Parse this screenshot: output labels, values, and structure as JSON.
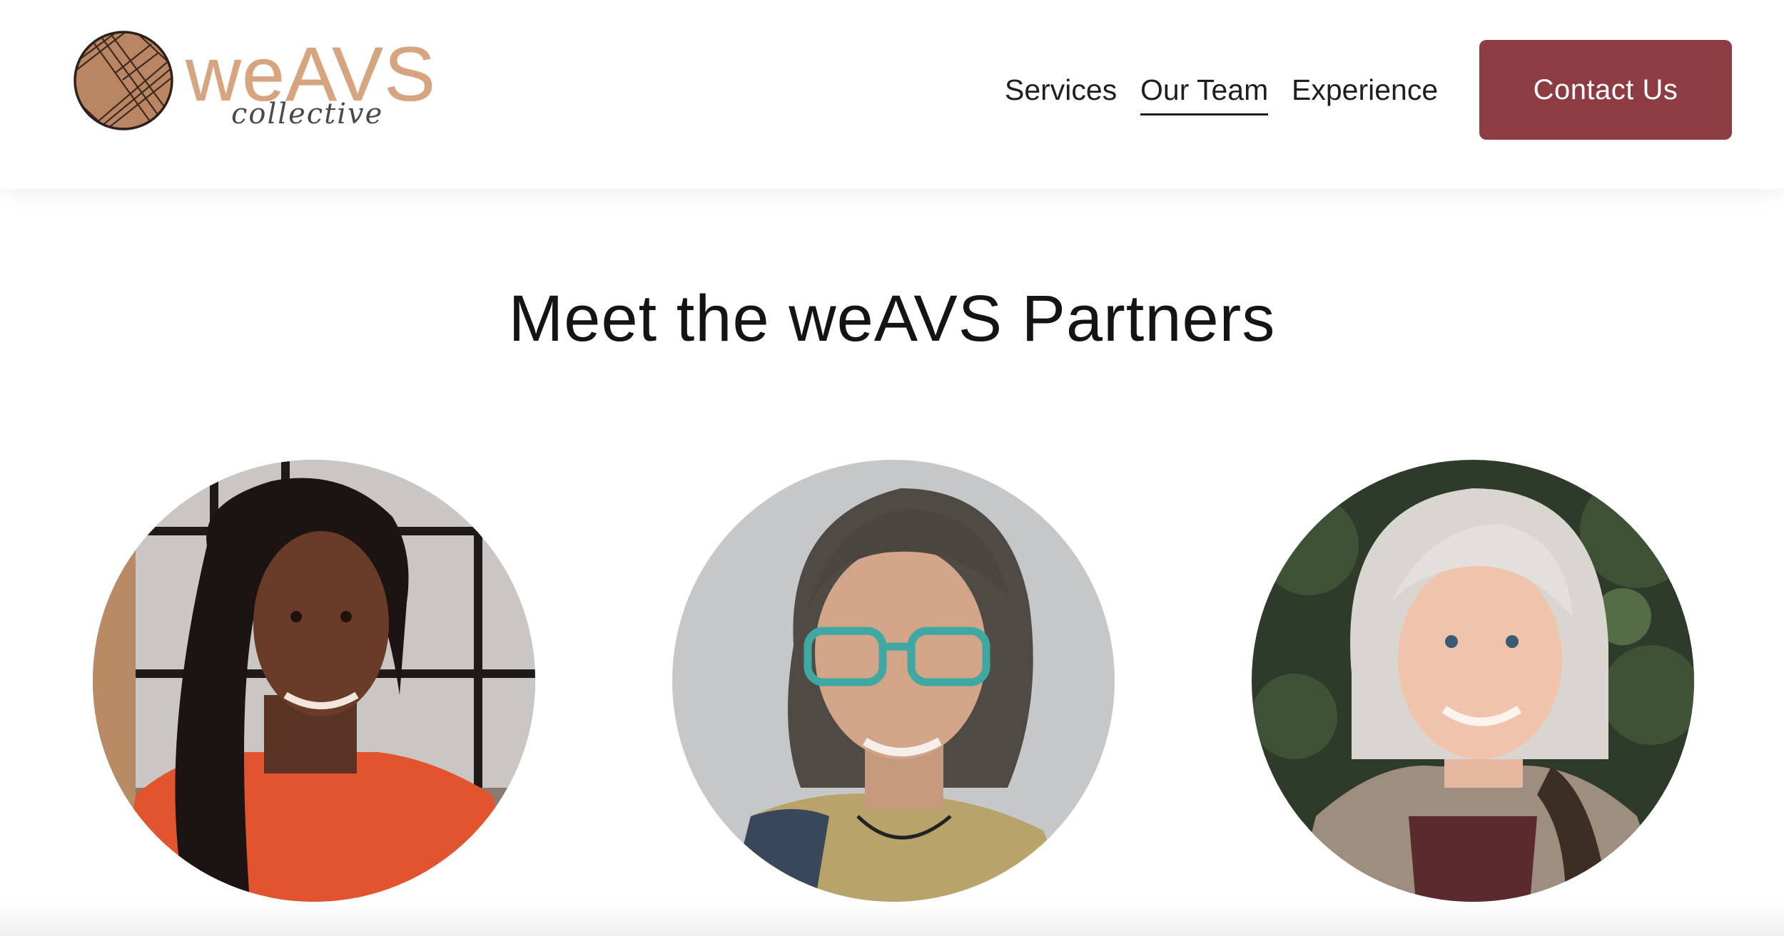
{
  "header": {
    "logo": {
      "wordmark": "weAVS",
      "script": "collective",
      "icon": "yarn-ball-icon"
    },
    "nav": [
      {
        "label": "Services",
        "active": false
      },
      {
        "label": "Our Team",
        "active": true
      },
      {
        "label": "Experience",
        "active": false
      }
    ],
    "cta_label": "Contact Us"
  },
  "main": {
    "title": "Meet the weAVS Partners"
  },
  "colors": {
    "brand_accent": "#8e3c44",
    "logo_tan": "#d6a47f",
    "text_dark": "#1f1f1f"
  }
}
